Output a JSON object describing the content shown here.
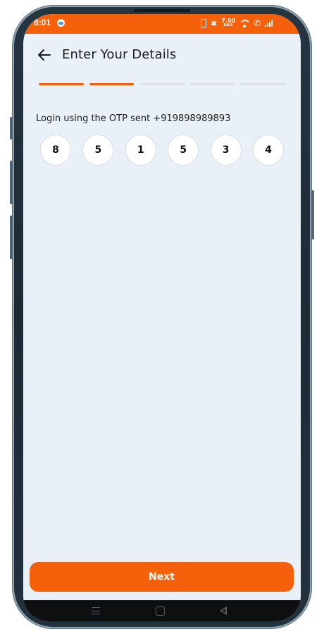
{
  "status_bar": {
    "time": "8:01",
    "net_speed": "7.00",
    "net_unit": "KB/S"
  },
  "header": {
    "title": "Enter Your Details",
    "back_icon": "arrow-left-icon"
  },
  "progress": {
    "total_steps": 5,
    "completed_steps": 2
  },
  "otp": {
    "label": "Login using the OTP sent +919898989893",
    "digits": [
      "8",
      "5",
      "1",
      "5",
      "3",
      "4"
    ]
  },
  "footer": {
    "next_label": "Next"
  },
  "colors": {
    "accent": "#f5600a",
    "background": "#e9f0f7",
    "inactive_step": "#dcdfe3"
  }
}
